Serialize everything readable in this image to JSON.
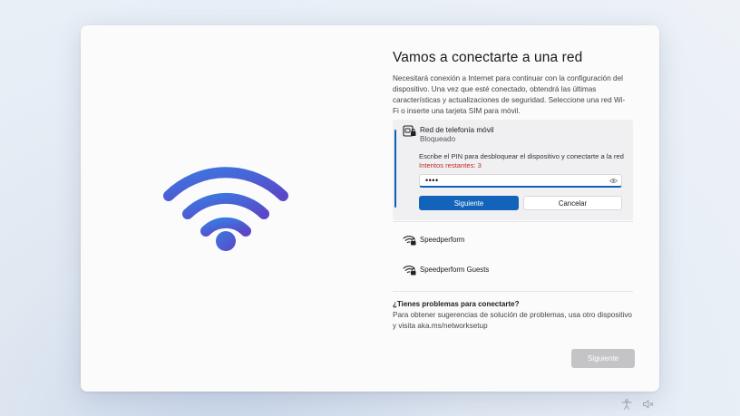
{
  "page": {
    "title": "Vamos a conectarte a una red",
    "description": "Necesitará conexión a Internet para continuar con la configuración del dispositivo. Una vez que esté conectado, obtendrá las últimas características y actualizaciones de seguridad. Seleccione una red Wi-Fi o inserte una tarjeta SIM para móvil."
  },
  "networks": {
    "selected": {
      "name": "Red de telefonía móvil",
      "status": "Bloqueado",
      "pin_info": "Escribe el PIN para desbloquear el dispositivo y conectarte a la red",
      "attempts": "Intentos restantes: 3",
      "pin_value": "••••",
      "next_label": "Siguiente",
      "cancel_label": "Cancelar"
    },
    "items": [
      {
        "name": "Speedperform"
      },
      {
        "name": "Speedperform Guests"
      }
    ]
  },
  "help": {
    "title": "¿Tienes problemas para conectarte?",
    "text": "Para obtener sugerencias de solución de problemas, usa otro dispositivo y visita aka.ms/networksetup"
  },
  "footer": {
    "next_label": "Siguiente"
  },
  "icons": {
    "hero": "wifi-icon",
    "mobile_network": "sim-card-lock-icon",
    "secured_wifi": "wifi-lock-icon",
    "tray_accessibility": "accessibility-icon",
    "tray_volume": "volume-mute-icon"
  },
  "colors": {
    "accent": "#1263b9",
    "error": "#c42b1c",
    "disabled": "#c4c4c6"
  }
}
